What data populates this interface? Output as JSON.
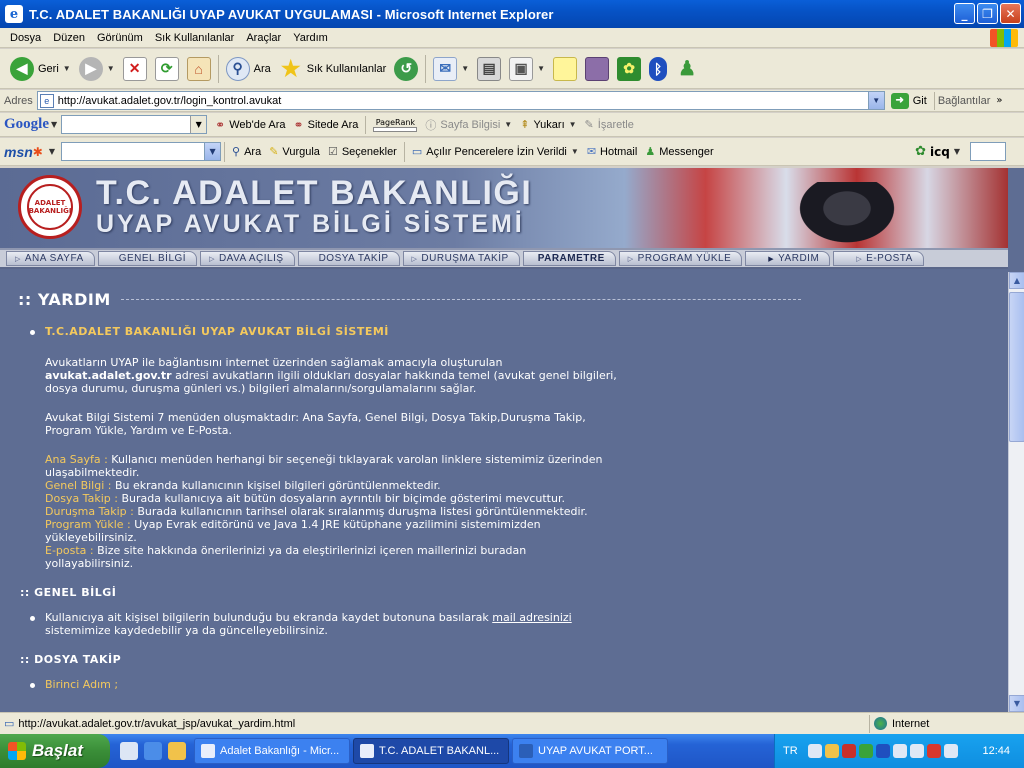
{
  "window": {
    "title": "T.C. ADALET BAKANLIĞI UYAP AVUKAT UYGULAMASI - Microsoft Internet Explorer",
    "buttons": {
      "minimize": "_",
      "maximize": "❐",
      "close": "✕"
    }
  },
  "menubar": {
    "items": [
      "Dosya",
      "Düzen",
      "Görünüm",
      "Sık Kullanılanlar",
      "Araçlar",
      "Yardım"
    ]
  },
  "toolbar": {
    "back_label": "Geri",
    "search_label": "Ara",
    "favorites_label": "Sık Kullanılanlar"
  },
  "address_bar": {
    "label": "Adres",
    "url": "http://avukat.adalet.gov.tr/login_kontrol.avukat",
    "go_label": "Git",
    "links_label": "Bağlantılar"
  },
  "google_bar": {
    "logo": "Google",
    "web_search": "Web'de Ara",
    "site_search": "Sitede Ara",
    "pagerank": "PageRank",
    "page_info": "Sayfa Bilgisi",
    "up": "Yukarı",
    "highlight": "İşaretle"
  },
  "msn_bar": {
    "logo": "msn",
    "search": "Ara",
    "highlight": "Vurgula",
    "options": "Seçenekler",
    "popups": "Açılır Pencerelere İzin Verildi",
    "hotmail": "Hotmail",
    "messenger": "Messenger",
    "icq": "icq"
  },
  "banner": {
    "title": "T.C. ADALET BAKANLIĞI",
    "subtitle": "UYAP AVUKAT BİLGİ SİSTEMİ",
    "seal_text": "ADALET BAKANLIĞI"
  },
  "nav": {
    "tabs": [
      "ANA SAYFA",
      "GENEL BİLGİ",
      "DAVA AÇILIŞ",
      "DOSYA TAKİP",
      "DURUŞMA TAKİP",
      "PARAMETRE",
      "PROGRAM YÜKLE",
      "YARDIM",
      "E-POSTA"
    ],
    "active": "YARDIM"
  },
  "page": {
    "title": ":: YARDIM",
    "intro": {
      "heading": "T.C.ADALET BAKANLIĞI UYAP AVUKAT BİLGİ SİSTEMİ",
      "p1_a": "Avukatların UYAP ile bağlantısını internet üzerinden sağlamak amacıyla oluşturulan",
      "p1_bold": "avukat.adalet.gov.tr",
      "p1_b": "adresi avukatların ilgili oldukları dosyalar hakkında temel (avukat genel bilgileri, dosya durumu, duruşma günleri vs.) bilgileri almalarını/sorgulamalarını sağlar.",
      "p2": "Avukat Bilgi Sistemi 7 menüden oluşmaktadır: Ana Sayfa, Genel Bilgi, Dosya Takip,Duruşma Takip, Program Yükle, Yardım ve E-Posta.",
      "defs": [
        {
          "term": "Ana Sayfa :",
          "desc": "Kullanıcı menüden herhangi bir seçeneği tıklayarak varolan linklere sistemimiz üzerinden ulaşabilmektedir."
        },
        {
          "term": "Genel Bilgi :",
          "desc": "Bu ekranda kullanıcının kişisel bilgileri görüntülenmektedir."
        },
        {
          "term": "Dosya Takip :",
          "desc": "Burada kullanıcıya ait bütün dosyaların ayrıntılı bir biçimde gösterimi mevcuttur."
        },
        {
          "term": "Duruşma Takip :",
          "desc": "Burada kullanıcının tarihsel olarak sıralanmış duruşma listesi görüntülenmektedir."
        },
        {
          "term": "Program Yükle :",
          "desc": "Uyap Evrak editörünü ve Java 1.4 JRE kütüphane yazilimini sistemimizden yükleyebilirsiniz."
        },
        {
          "term": "E-posta :",
          "desc": "Bize site hakkında önerilerinizi ya da eleştirilerinizi içeren maillerinizi buradan yollayabilirsiniz."
        }
      ]
    },
    "genel_bilgi": {
      "title": ":: GENEL BİLGİ",
      "text_a": "Kullanıcıya ait kişisel bilgilerin bulunduğu bu ekranda kaydet butonuna basılarak",
      "link": "mail adresinizi",
      "text_b": "sistemimize kaydedebilir ya da güncelleyebilirsiniz."
    },
    "dosya_takip": {
      "title": ":: DOSYA TAKİP",
      "item1": "Birinci Adım ;"
    }
  },
  "statusbar": {
    "url": "http://avukat.adalet.gov.tr/avukat_jsp/avukat_yardim.html",
    "zone": "Internet"
  },
  "taskbar": {
    "start": "Başlat",
    "tasks": [
      "Adalet Bakanlığı - Micr...",
      "T.C. ADALET BAKANL...",
      "UYAP AVUKAT PORT..."
    ],
    "language": "TR",
    "clock": "12:44"
  }
}
